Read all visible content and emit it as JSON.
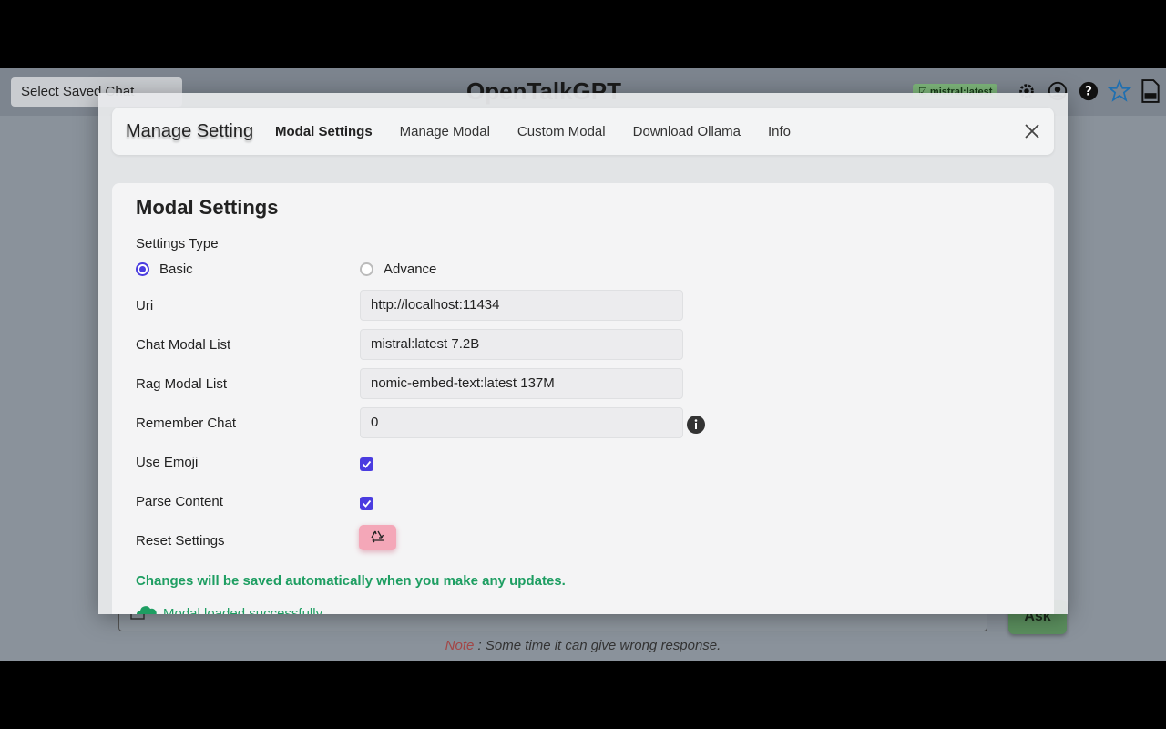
{
  "app": {
    "saved_chat_select": "Select Saved Chat",
    "title": "OpenTalkGPT",
    "model_badge": "mistral:latest",
    "ask_label": "Ask",
    "note_label": "Note",
    "note_text": " : Some time it can give wrong response."
  },
  "modal": {
    "title": "Manage Setting",
    "tabs": [
      {
        "label": "Modal Settings",
        "active": true
      },
      {
        "label": "Manage Modal",
        "active": false
      },
      {
        "label": "Custom Modal",
        "active": false
      },
      {
        "label": "Download Ollama",
        "active": false
      },
      {
        "label": "Info",
        "active": false
      }
    ],
    "panel": {
      "heading": "Modal Settings",
      "settings_type_label": "Settings Type",
      "radio_basic": "Basic",
      "radio_advance": "Advance",
      "selected_type": "Basic",
      "uri_label": "Uri",
      "uri_value": "http://localhost:11434",
      "chat_modal_label": "Chat Modal List",
      "chat_modal_value": "mistral:latest 7.2B",
      "rag_modal_label": "Rag Modal List",
      "rag_modal_value": "nomic-embed-text:latest 137M",
      "remember_chat_label": "Remember Chat",
      "remember_chat_value": "0",
      "use_emoji_label": "Use Emoji",
      "use_emoji_checked": true,
      "parse_content_label": "Parse Content",
      "parse_content_checked": true,
      "reset_settings_label": "Reset Settings",
      "save_note": "Changes will be saved automatically when you make any updates.",
      "status_text": "Modal loaded successfully"
    }
  },
  "colors": {
    "accent": "#4a3ce0",
    "success": "#1e9e62",
    "reset_button": "#f4a7b8"
  },
  "icons": {
    "settings": "gear-icon",
    "account": "user-circle-icon",
    "help": "question-icon",
    "theme": "star-icon",
    "download": "file-download-icon",
    "close": "close-icon",
    "info": "info-icon",
    "reset": "recycle-icon",
    "status": "cloud-icon"
  }
}
